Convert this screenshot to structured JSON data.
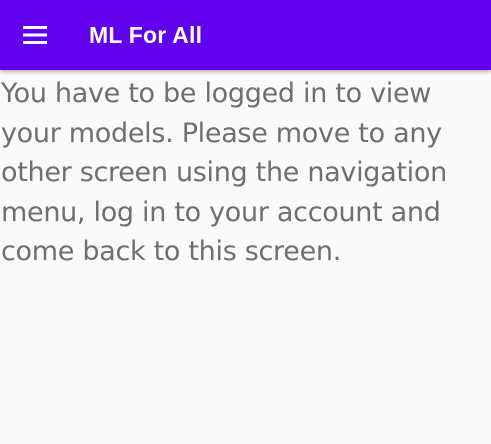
{
  "app_bar": {
    "title": "ML For All",
    "menu_icon": "hamburger-menu-icon",
    "background_color": "#6200ee"
  },
  "main": {
    "message": "You have to be logged in to view your models. Please move to any other screen using the navigation menu, log in to your account and come back to this screen.",
    "text_color": "#6f6f6f"
  }
}
